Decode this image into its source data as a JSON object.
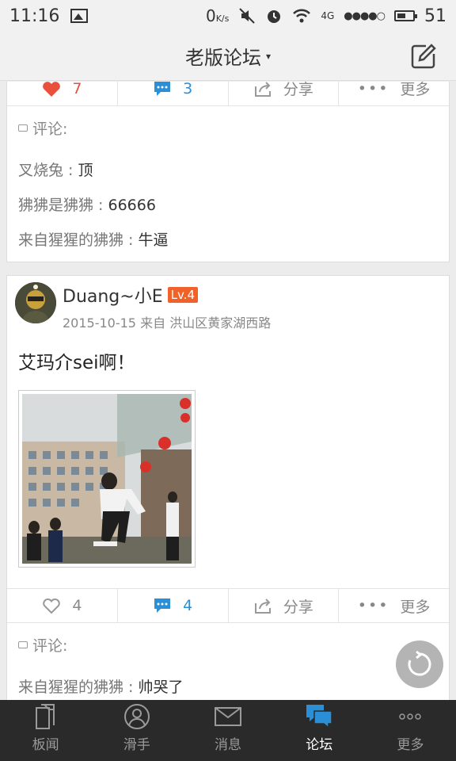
{
  "status": {
    "time": "11:16",
    "speed": "0",
    "speed_unit": "K/s",
    "network": "4G",
    "battery": "51"
  },
  "nav": {
    "title": "老版论坛",
    "caret": "▾"
  },
  "prev_post": {
    "likes": "7",
    "comments": "3",
    "share_label": "分享",
    "more_label": "更多",
    "comments_header": "评论:",
    "comment_list": [
      {
        "author": "叉烧兔",
        "text": "顶"
      },
      {
        "author": "狒狒是狒狒",
        "text": "66666"
      },
      {
        "author": "来自猩猩的狒狒",
        "text": "牛逼"
      }
    ]
  },
  "post": {
    "author": "Duang~小E",
    "level": "Lv.4",
    "date": "2015-10-15",
    "from_label": "来自",
    "location": "洪山区黄家湖西路",
    "title": "艾玛介sei啊！",
    "likes": "4",
    "comments": "4",
    "share_label": "分享",
    "more_label": "更多",
    "comments_header": "评论:",
    "comment_list": [
      {
        "author": "来自猩猩的狒狒",
        "text": "帅哭了"
      }
    ]
  },
  "tabs": [
    {
      "label": "板闻",
      "icon": "document-icon"
    },
    {
      "label": "滑手",
      "icon": "user-icon"
    },
    {
      "label": "消息",
      "icon": "mail-icon"
    },
    {
      "label": "论坛",
      "icon": "chat-icon"
    },
    {
      "label": "更多",
      "icon": "more-icon"
    }
  ],
  "colors": {
    "like_red": "#e8513b",
    "accent_blue": "#2a8fd6",
    "level_badge": "#f0622a",
    "tab_bar_bg": "#2a2a2a"
  }
}
